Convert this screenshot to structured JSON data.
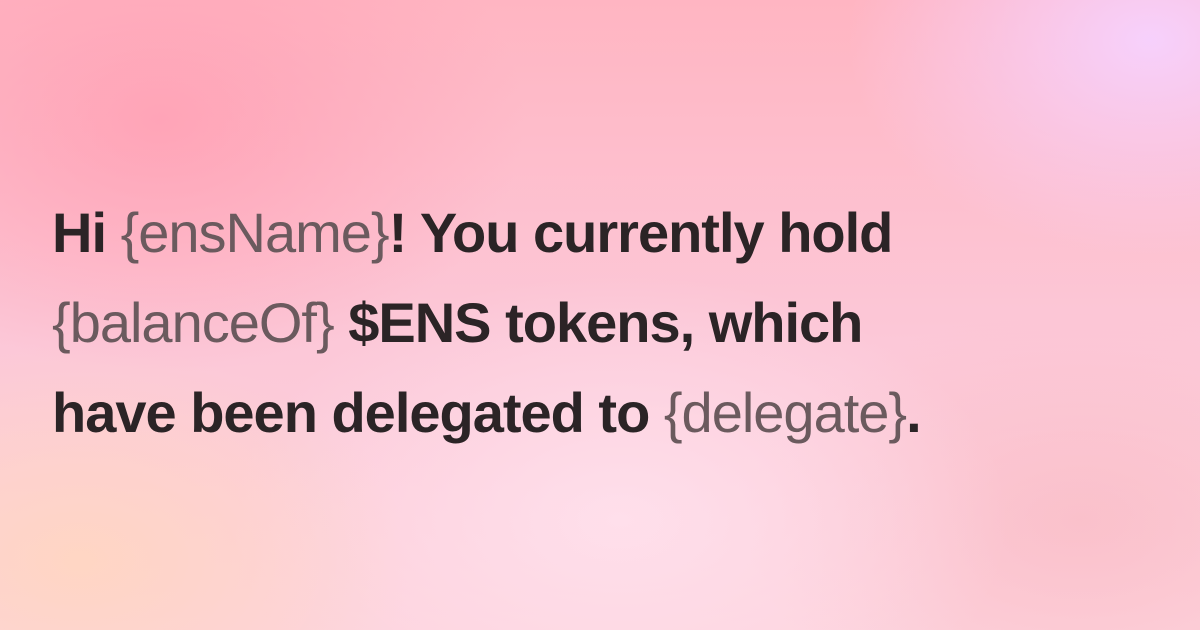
{
  "message": {
    "line1": {
      "prefix": "Hi ",
      "placeholder": "{ensName}",
      "suffix": "! You currently hold"
    },
    "line2": {
      "placeholder": "{balanceOf}",
      "suffix": " $ENS tokens, which"
    },
    "line3": {
      "prefix": "have been delegated to ",
      "placeholder": "{delegate}",
      "suffix": "."
    }
  },
  "colors": {
    "text": "#2b2426",
    "placeholder": "#6b5a5e",
    "background_pink": "#ffb5c2",
    "background_lavender": "#f6d2ff",
    "background_peach": "#ffd6c2"
  }
}
